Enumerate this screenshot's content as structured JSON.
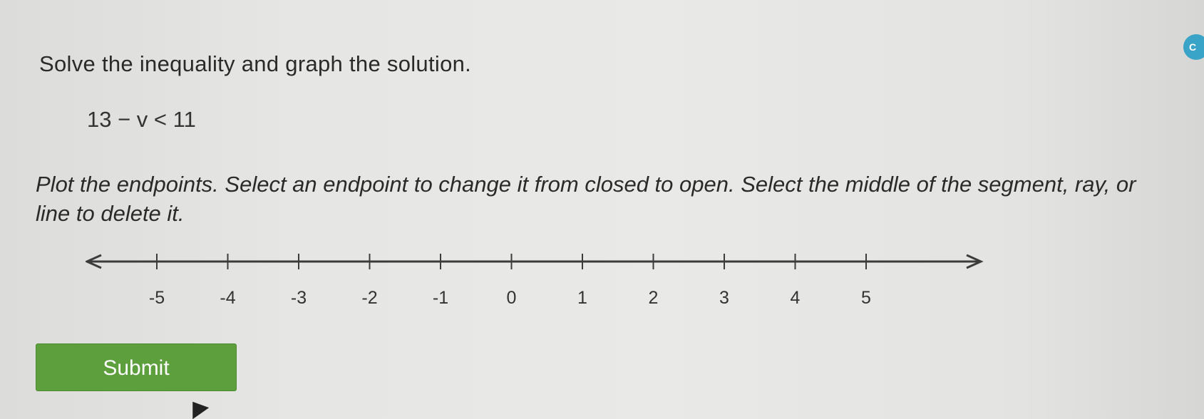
{
  "question": {
    "heading": "Solve the inequality and graph the solution.",
    "expression": "13 − v < 11",
    "instructions": "Plot the endpoints. Select an endpoint to change it from closed to open. Select the middle of the segment, ray, or line to delete it."
  },
  "number_line": {
    "ticks": [
      "-5",
      "-4",
      "-3",
      "-2",
      "-1",
      "0",
      "1",
      "2",
      "3",
      "4",
      "5"
    ]
  },
  "submit": {
    "label": "Submit",
    "color": "#5d9e3d"
  },
  "corner_badge": {
    "icon": "circle-badge-icon",
    "label": "C"
  }
}
